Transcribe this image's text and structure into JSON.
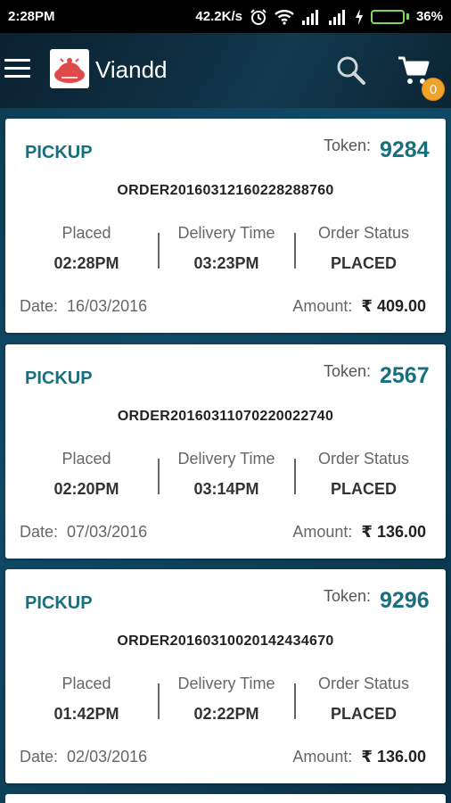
{
  "status_bar": {
    "time": "2:28PM",
    "network_speed": "42.2K/s",
    "battery": "36%",
    "battery_level": 0.36,
    "icons": [
      "alarm-icon",
      "wifi-icon",
      "signal-icon",
      "signal-icon",
      "charging-icon",
      "battery-icon"
    ]
  },
  "app_bar": {
    "title": "Viandd",
    "cart_count": "0",
    "icons": [
      "menu-icon",
      "logo-icon",
      "search-icon",
      "cart-icon"
    ]
  },
  "orders": [
    {
      "type": "PICKUP",
      "token_label": "Token:",
      "token": "9284",
      "order_id": "ORDER20160312160228288760",
      "placed_label": "Placed",
      "placed": "02:28PM",
      "delivery_label": "Delivery Time",
      "delivery": "03:23PM",
      "status_label": "Order Status",
      "status": "PLACED",
      "date_label": "Date:",
      "date": "16/03/2016",
      "amount_label": "Amount:",
      "currency": "₹",
      "amount": "409.00"
    },
    {
      "type": "PICKUP",
      "token_label": "Token:",
      "token": "2567",
      "order_id": "ORDER20160311070220022740",
      "placed_label": "Placed",
      "placed": "02:20PM",
      "delivery_label": "Delivery Time",
      "delivery": "03:14PM",
      "status_label": "Order Status",
      "status": "PLACED",
      "date_label": "Date:",
      "date": "07/03/2016",
      "amount_label": "Amount:",
      "currency": "₹",
      "amount": "136.00"
    },
    {
      "type": "PICKUP",
      "token_label": "Token:",
      "token": "9296",
      "order_id": "ORDER20160310020142434670",
      "placed_label": "Placed",
      "placed": "01:42PM",
      "delivery_label": "Delivery Time",
      "delivery": "02:22PM",
      "status_label": "Order Status",
      "status": "PLACED",
      "date_label": "Date:",
      "date": "02/03/2016",
      "amount_label": "Amount:",
      "currency": "₹",
      "amount": "136.00"
    }
  ],
  "colors": {
    "accent": "#17707f",
    "badge": "#f0a32a",
    "logo": "#e04a4a",
    "battery": "#7ed957"
  }
}
